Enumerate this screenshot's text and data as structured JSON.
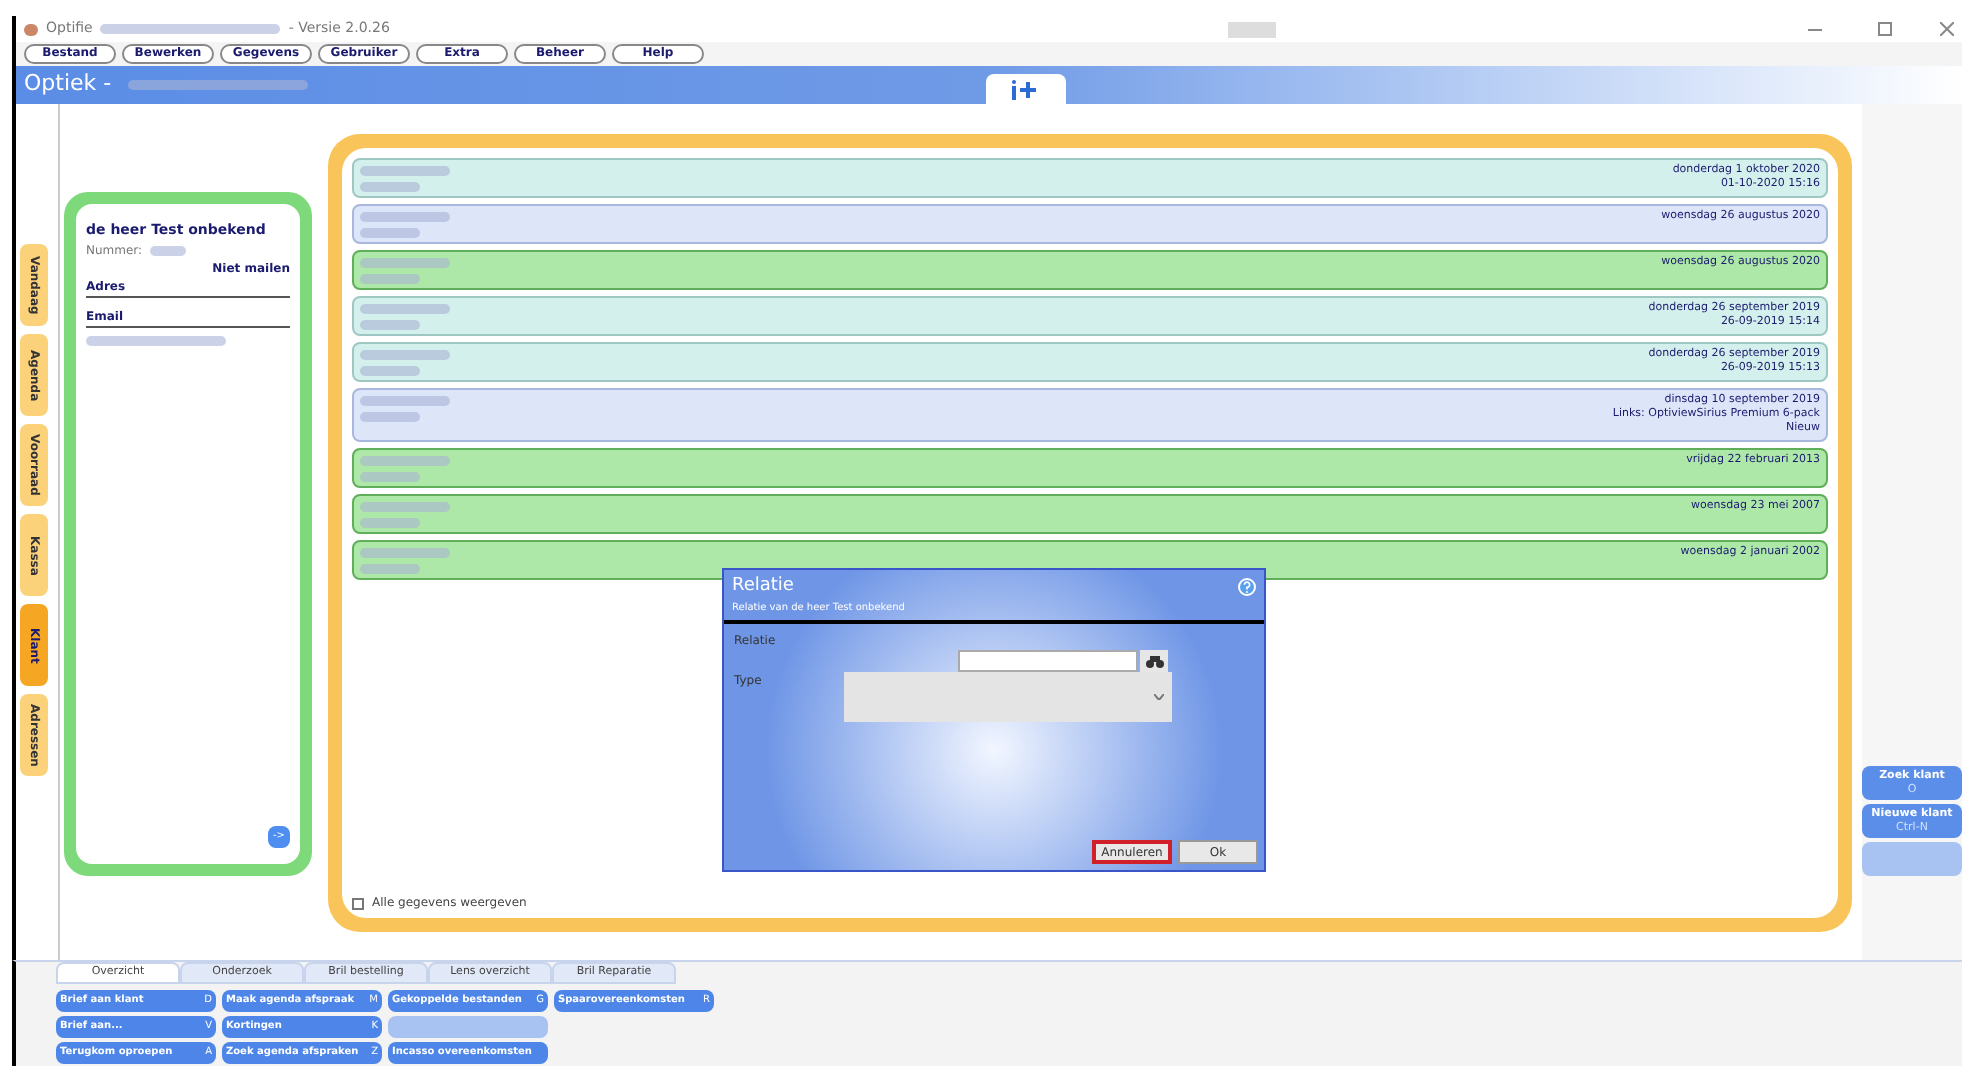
{
  "window": {
    "title_app": "Optifie",
    "title_version": "- Versie 2.0.26"
  },
  "menu": [
    "Bestand",
    "Bewerken",
    "Gegevens",
    "Gebruiker",
    "Extra",
    "Beheer",
    "Help"
  ],
  "header": {
    "title": "Optiek -"
  },
  "side_tabs": [
    {
      "label": "Vandaag",
      "selected": false
    },
    {
      "label": "Agenda",
      "selected": false
    },
    {
      "label": "Voorraad",
      "selected": false
    },
    {
      "label": "Kassa",
      "selected": false
    },
    {
      "label": "Klant",
      "selected": true
    },
    {
      "label": "Adressen",
      "selected": false
    }
  ],
  "client": {
    "name": "de heer Test onbekend",
    "number_label": "Nummer:",
    "mail_flag": "Niet mailen",
    "address_label": "Adres",
    "email_label": "Email",
    "next_button": "->"
  },
  "timeline": [
    {
      "kind": "appointment",
      "lines": [
        "donderdag 1 oktober 2020",
        "01-10-2020 15:16"
      ]
    },
    {
      "kind": "order",
      "lines": [
        "woensdag 26 augustus 2020"
      ]
    },
    {
      "kind": "exam",
      "lines": [
        "woensdag 26 augustus 2020"
      ]
    },
    {
      "kind": "appointment",
      "lines": [
        "donderdag 26 september 2019",
        "26-09-2019 15:14"
      ]
    },
    {
      "kind": "appointment",
      "lines": [
        "donderdag 26 september 2019",
        "26-09-2019 15:13"
      ]
    },
    {
      "kind": "order",
      "lines": [
        "dinsdag 10 september 2019",
        "Links: OptiviewSirius Premium 6-pack",
        "Nieuw"
      ]
    },
    {
      "kind": "exam",
      "lines": [
        "vrijdag 22 februari 2013"
      ]
    },
    {
      "kind": "exam",
      "lines": [
        "woensdag 23 mei 2007"
      ]
    },
    {
      "kind": "exam",
      "lines": [
        "woensdag 2 januari 2002"
      ]
    }
  ],
  "show_all": {
    "label": "Alle gegevens weergeven",
    "checked": false
  },
  "dialog": {
    "title": "Relatie",
    "subtitle": "Relatie van de heer Test onbekend",
    "relation_label": "Relatie",
    "type_label": "Type",
    "cancel": "Annuleren",
    "ok": "Ok",
    "cancel_focused": true
  },
  "quick_buttons": [
    {
      "label": "Zoek klant",
      "shortcut": "O",
      "disabled": false
    },
    {
      "label": "Nieuwe klant",
      "shortcut": "Ctrl-N",
      "disabled": false
    },
    {
      "disabled": true
    }
  ],
  "bottom_tabs": [
    {
      "label": "Overzicht",
      "selected": true
    },
    {
      "label": "Onderzoek",
      "selected": false
    },
    {
      "label": "Bril bestelling",
      "selected": false
    },
    {
      "label": "Lens overzicht",
      "selected": false
    },
    {
      "label": "Bril Reparatie",
      "selected": false
    }
  ],
  "actions": [
    [
      {
        "label": "Brief aan klant",
        "shortcut": "D",
        "disabled": false
      },
      {
        "label": "Maak agenda afspraak",
        "shortcut": "M",
        "disabled": false
      },
      {
        "label": "Gekoppelde bestanden",
        "shortcut": "G",
        "disabled": false
      },
      {
        "label": "Spaarovereenkomsten",
        "shortcut": "R",
        "disabled": false
      }
    ],
    [
      {
        "label": "Brief aan...",
        "shortcut": "V",
        "disabled": false
      },
      {
        "label": "Kortingen",
        "shortcut": "K",
        "disabled": false
      },
      {
        "disabled": true
      }
    ],
    [
      {
        "label": "Terugkom oproepen",
        "shortcut": "A",
        "disabled": false
      },
      {
        "label": "Zoek agenda afspraken",
        "shortcut": "Z",
        "disabled": false
      },
      {
        "label": "Incasso overeenkomsten",
        "disabled": false
      }
    ]
  ]
}
